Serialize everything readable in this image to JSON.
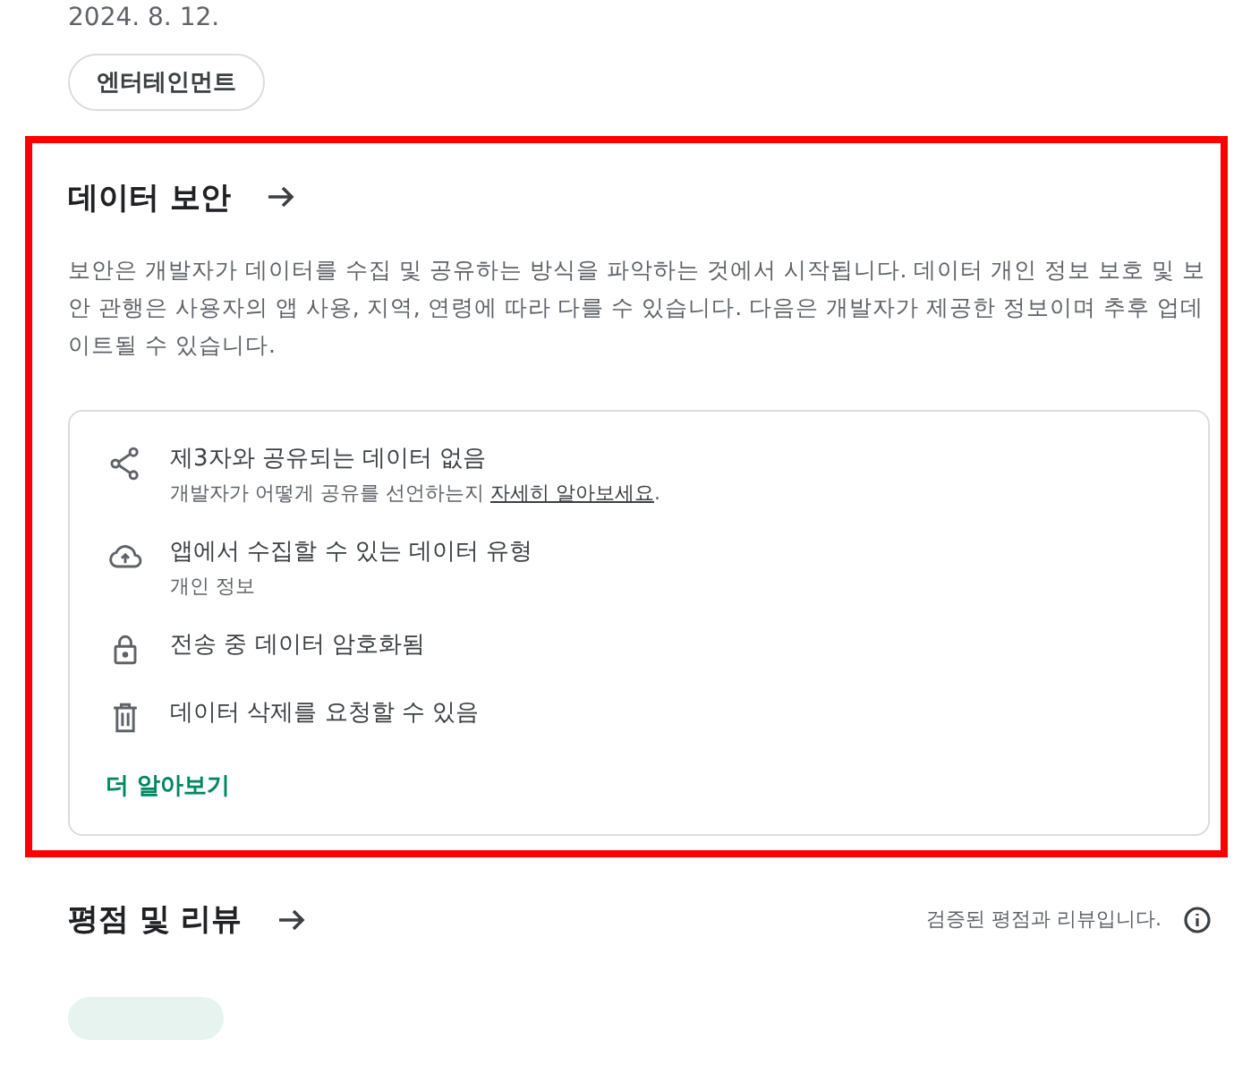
{
  "date": "2024. 8. 12.",
  "category_chip": "엔터테인먼트",
  "data_safety": {
    "title": "데이터 보안",
    "description": "보안은 개발자가 데이터를 수집 및 공유하는 방식을 파악하는 것에서 시작됩니다. 데이터 개인 정보 보호 및 보안 관행은 사용자의 앱 사용, 지역, 연령에 따라 다를 수 있습니다. 다음은 개발자가 제공한 정보이며 추후 업데이트될 수 있습니다.",
    "items": [
      {
        "title": "제3자와 공유되는 데이터 없음",
        "subtitle": "개발자가 어떻게 공유를 선언하는지 ",
        "subtitle_link": "자세히 알아보세요",
        "subtitle_end": "."
      },
      {
        "title": "앱에서 수집할 수 있는 데이터 유형",
        "subtitle": "개인 정보"
      },
      {
        "title": "전송 중 데이터 암호화됨"
      },
      {
        "title": "데이터 삭제를 요청할 수 있음"
      }
    ],
    "more_link": "더 알아보기"
  },
  "ratings": {
    "title": "평점 및 리뷰",
    "note": "검증된 평점과 리뷰입니다."
  }
}
